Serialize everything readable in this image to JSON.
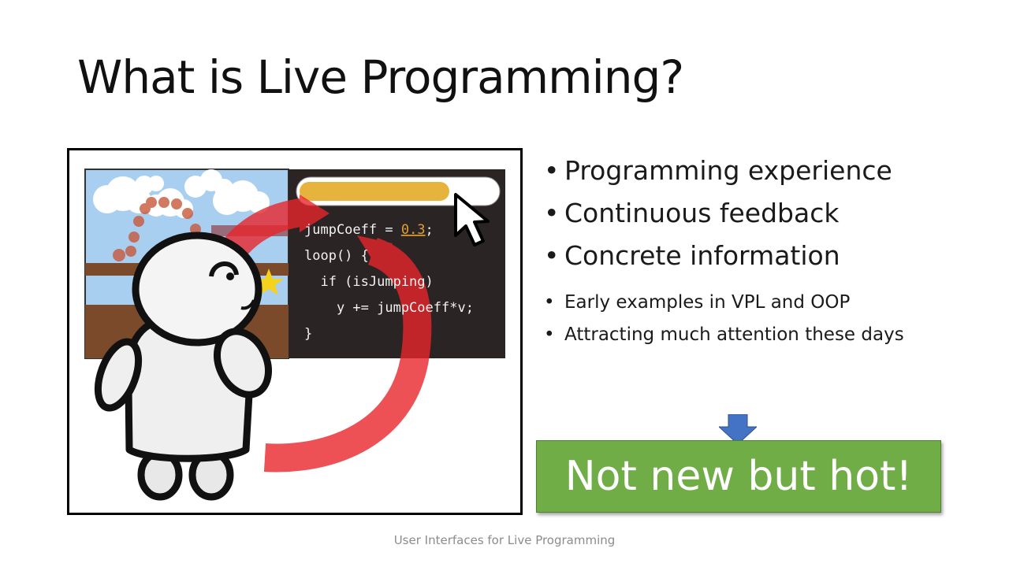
{
  "slide": {
    "title": "What is Live Programming?",
    "bullets": [
      "Programming experience",
      "Continuous feedback",
      "Concrete information"
    ],
    "sub_bullets": [
      "Early examples in VPL and OOP",
      "Attracting much attention these days"
    ],
    "bullet_glyph": "•",
    "callout_text": "Not new but hot!",
    "footer": "User Interfaces for Live Programming"
  },
  "illustration": {
    "code_lines": [
      {
        "pre": "jumpCoeff = ",
        "value": "0.3",
        "post": ";"
      },
      {
        "text": "loop() {"
      },
      {
        "text": "  if (isJumping)"
      },
      {
        "text": "    y += jumpCoeff*v;"
      },
      {
        "text": "}"
      }
    ],
    "slider_value": 0.76
  },
  "colors": {
    "callout_green": "#70ad47",
    "arrow_blue": "#4472c4",
    "code_bg": "#2b2424",
    "slider_fill": "#e6b43c",
    "number_highlight": "#e0a030",
    "feedback_arrow": "#e8262b",
    "sky": "#a9cff0",
    "ground": "#7a4a2a"
  },
  "icons": [
    "mouse-cursor-icon",
    "star-icon",
    "down-arrow-icon"
  ]
}
